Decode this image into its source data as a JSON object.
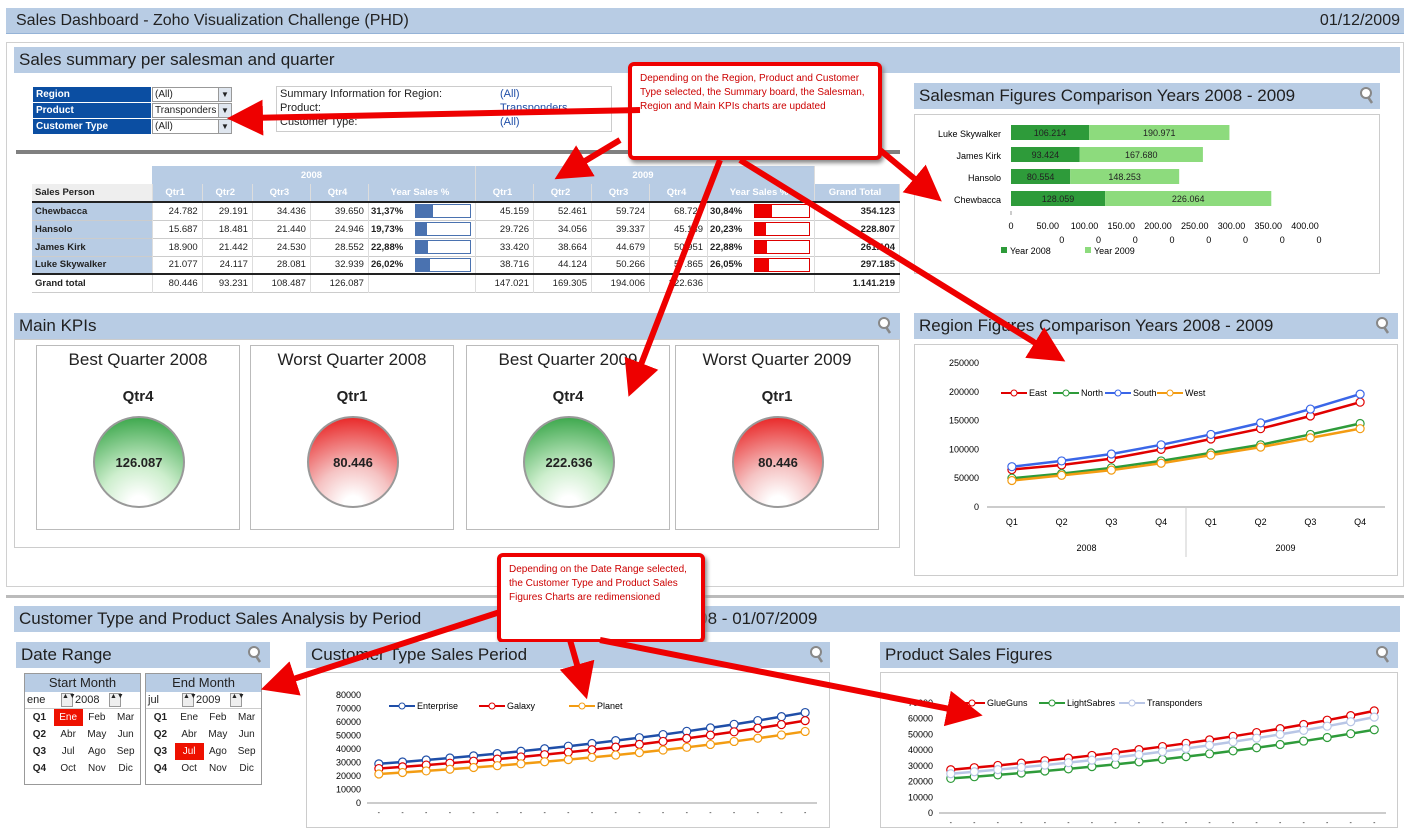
{
  "app": {
    "title": "Sales Dashboard - Zoho Visualization Challenge (PHD)",
    "date": "01/12/2009"
  },
  "summary": {
    "title": "Sales summary per salesman and quarter",
    "filters": [
      {
        "label": "Region",
        "value": "(All)"
      },
      {
        "label": "Product",
        "value": "Transponders"
      },
      {
        "label": "Customer Type",
        "value": "(All)"
      }
    ],
    "info": [
      {
        "label": "Summary Information for Region:",
        "value": "(All)"
      },
      {
        "label": "Product:",
        "value": "Transponders"
      },
      {
        "label": "Customer Type:",
        "value": "(All)"
      }
    ],
    "table": {
      "year1": "2008",
      "year2": "2009",
      "col_person": "Sales Person",
      "quarters": [
        "Qtr1",
        "Qtr2",
        "Qtr3",
        "Qtr4"
      ],
      "year_pct": "Year Sales %",
      "grand_total_label": "Grand Total",
      "rows": [
        {
          "name": "Chewbacca",
          "y1": [
            "24.782",
            "29.191",
            "34.436",
            "39.650"
          ],
          "p1": "31,37%",
          "f1": 0.31,
          "y2": [
            "45.159",
            "52.461",
            "59.724",
            "68.720"
          ],
          "p2": "30,84%",
          "f2": 0.31,
          "total": "354.123"
        },
        {
          "name": "Hansolo",
          "y1": [
            "15.687",
            "18.481",
            "21.440",
            "24.946"
          ],
          "p1": "19,73%",
          "f1": 0.2,
          "y2": [
            "29.726",
            "34.056",
            "39.337",
            "45.139"
          ],
          "p2": "20,23%",
          "f2": 0.2,
          "total": "228.807"
        },
        {
          "name": "James Kirk",
          "y1": [
            "18.900",
            "21.442",
            "24.530",
            "28.552"
          ],
          "p1": "22,88%",
          "f1": 0.23,
          "y2": [
            "33.420",
            "38.664",
            "44.679",
            "50.951"
          ],
          "p2": "22,88%",
          "f2": 0.23,
          "total": "261.104"
        },
        {
          "name": "Luke Skywalker",
          "y1": [
            "21.077",
            "24.117",
            "28.081",
            "32.939"
          ],
          "p1": "26,02%",
          "f1": 0.26,
          "y2": [
            "38.716",
            "44.124",
            "50.266",
            "57.865"
          ],
          "p2": "26,05%",
          "f2": 0.26,
          "total": "297.185"
        }
      ],
      "grand": {
        "name": "Grand total",
        "y1": [
          "80.446",
          "93.231",
          "108.487",
          "126.087"
        ],
        "y2": [
          "147.021",
          "169.305",
          "194.006",
          "222.636"
        ],
        "total": "1.141.219"
      }
    }
  },
  "callouts": {
    "c1": "Depending on the Region, Product and Customer Type selected, the Summary board, the Salesman, Region and Main KPIs charts are updated",
    "c2": "Depending on the Date Range selected, the Customer Type and Product Sales Figures Charts are redimensioned"
  },
  "kpis": {
    "title": "Main KPIs",
    "items": [
      {
        "title": "Best Quarter 2008",
        "quarter": "Qtr4",
        "value": "126.087",
        "color": "green"
      },
      {
        "title": "Worst Quarter 2008",
        "quarter": "Qtr1",
        "value": "80.446",
        "color": "red"
      },
      {
        "title": "Best Quarter 2009",
        "quarter": "Qtr4",
        "value": "222.636",
        "color": "green"
      },
      {
        "title": "Worst Quarter 2009",
        "quarter": "Qtr1",
        "value": "80.446",
        "color": "red"
      }
    ]
  },
  "period": {
    "title": "Customer Type and Product Sales Analysis by Period",
    "range": "01/01/2008 - 01/07/2009",
    "date_range": {
      "title": "Date Range",
      "start": {
        "label": "Start Month",
        "month": "ene",
        "year": "2008",
        "months": [
          [
            "Ene",
            "Feb",
            "Mar"
          ],
          [
            "Abr",
            "May",
            "Jun"
          ],
          [
            "Jul",
            "Ago",
            "Sep"
          ],
          [
            "Oct",
            "Nov",
            "Dic"
          ]
        ],
        "selected": "0-0"
      },
      "end": {
        "label": "End Month",
        "month": "jul",
        "year": "2009",
        "months": [
          [
            "Ene",
            "Feb",
            "Mar"
          ],
          [
            "Abr",
            "May",
            "Jun"
          ],
          [
            "Jul",
            "Ago",
            "Sep"
          ],
          [
            "Oct",
            "Nov",
            "Dic"
          ]
        ],
        "selected": "2-0"
      },
      "qlabels": [
        "Q1",
        "Q2",
        "Q3",
        "Q4"
      ]
    }
  },
  "colors": {
    "header": "#b8cce4",
    "year2008": "#2e9b3a",
    "year2009": "#8ddb7d",
    "east": "#e00000",
    "north": "#2e9b3a",
    "south": "#3a66e8",
    "west": "#f39c12",
    "enterprise": "#1f4ea8",
    "galaxy": "#e00000",
    "planet": "#f39c12",
    "glueguns": "#e00000",
    "lightsabres": "#2e9b3a",
    "transponders": "#b9c6e6"
  },
  "chart_data": [
    {
      "type": "bar",
      "title": "Salesman Figures Comparison Years 2008 - 2009",
      "categories": [
        "Luke Skywalker",
        "James Kirk",
        "Hansolo",
        "Chewbacca"
      ],
      "series": [
        {
          "name": "Year 2008",
          "values": [
            106.214,
            93.424,
            80.554,
            128.059
          ]
        },
        {
          "name": "Year 2009",
          "values": [
            190.971,
            167.68,
            148.253,
            226.064
          ]
        }
      ],
      "xticks": [
        "0",
        "50.000",
        "100.000",
        "150.000",
        "200.000",
        "250.000",
        "300.000",
        "350.000",
        "400.000"
      ],
      "xlim": [
        0,
        400
      ]
    },
    {
      "type": "line",
      "title": "Region Figures Comparison Years 2008 - 2009",
      "categories": [
        "Q1",
        "Q2",
        "Q3",
        "Q4",
        "Q1",
        "Q2",
        "Q3",
        "Q4"
      ],
      "groups": [
        "2008",
        "2009"
      ],
      "yticks": [
        "250000",
        "200000",
        "150000",
        "100000",
        "50000",
        "0"
      ],
      "ylim": [
        0,
        250000
      ],
      "series": [
        {
          "name": "East",
          "values": [
            65000,
            73000,
            84000,
            100000,
            118000,
            136000,
            158000,
            182000
          ]
        },
        {
          "name": "North",
          "values": [
            50000,
            58000,
            68000,
            80000,
            94000,
            108000,
            126000,
            145000
          ]
        },
        {
          "name": "South",
          "values": [
            70000,
            80000,
            92000,
            108000,
            126000,
            146000,
            170000,
            196000
          ]
        },
        {
          "name": "West",
          "values": [
            46000,
            55000,
            64000,
            76000,
            90000,
            104000,
            120000,
            136000
          ]
        }
      ]
    },
    {
      "type": "line",
      "title": "Customer Type Sales Period",
      "yticks": [
        "80000",
        "70000",
        "60000",
        "50000",
        "40000",
        "30000",
        "20000",
        "10000",
        "0"
      ],
      "ylim": [
        0,
        80000
      ],
      "series": [
        {
          "name": "Enterprise",
          "start": 29000,
          "end": 67000
        },
        {
          "name": "Galaxy",
          "start": 25500,
          "end": 61000
        },
        {
          "name": "Planet",
          "start": 21500,
          "end": 53000
        }
      ],
      "points": 19
    },
    {
      "type": "line",
      "title": "Product Sales Figures",
      "yticks": [
        "70000",
        "60000",
        "50000",
        "40000",
        "30000",
        "20000",
        "10000",
        "0"
      ],
      "ylim": [
        0,
        70000
      ],
      "series": [
        {
          "name": "GlueGuns",
          "start": 27500,
          "end": 65000
        },
        {
          "name": "LightSabres",
          "start": 22000,
          "end": 53000
        },
        {
          "name": "Transponders",
          "start": 25000,
          "end": 61000
        }
      ],
      "points": 19
    }
  ]
}
